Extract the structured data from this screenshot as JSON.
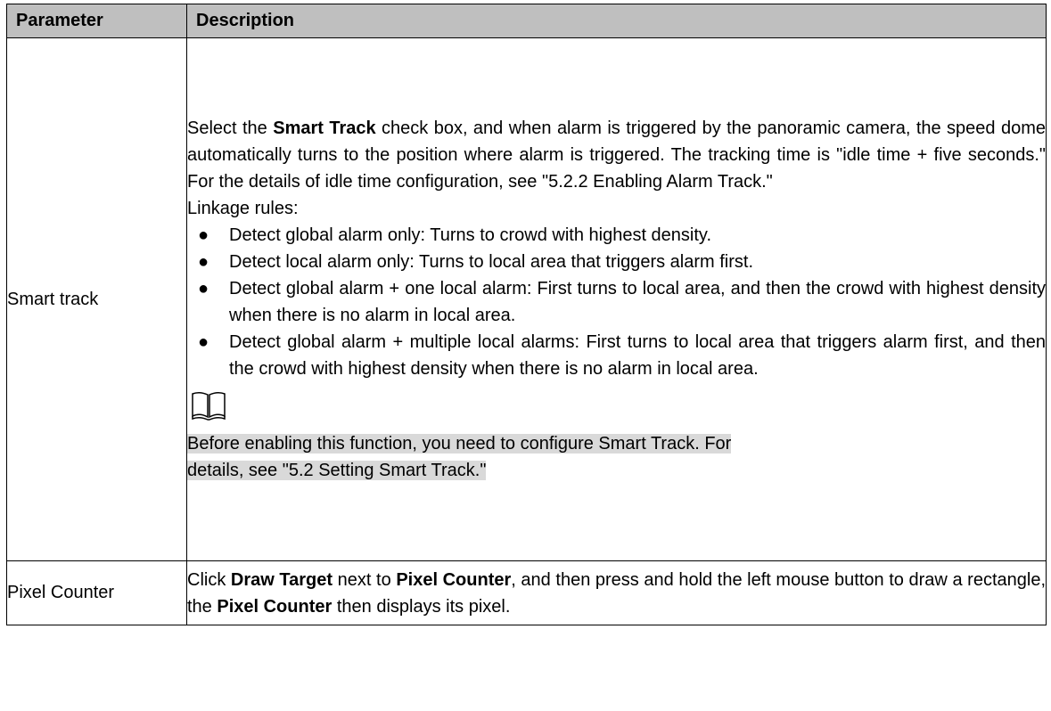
{
  "table": {
    "headers": {
      "parameter": "Parameter",
      "description": "Description"
    },
    "smart_track": {
      "name": "Smart track",
      "intro_1": "Select the ",
      "intro_bold": "Smart Track",
      "intro_2": " check box, and when alarm is triggered by the panoramic camera, the speed dome automatically turns to the position where alarm is triggered. The tracking time is \"idle time + five seconds.\" For the details of idle time configuration, see \"5.2.2 Enabling Alarm Track.\"",
      "rules_label": "Linkage rules:",
      "bullets": [
        "Detect global alarm only: Turns to crowd with highest density.",
        "Detect local alarm only: Turns to local area that triggers alarm first.",
        "Detect global alarm + one local alarm: First turns to local area, and then the crowd with highest density when there is no alarm in local area.",
        "Detect global alarm + multiple local alarms: First turns to local area that triggers alarm first, and then the crowd with highest density when there is no alarm in local area."
      ],
      "note_icon": "book-icon",
      "note_text_1": "Before enabling this function, you need to configure Smart Track. For",
      "note_text_2": "details, see \"5.2 Setting Smart Track.\""
    },
    "pixel_counter": {
      "name": "Pixel Counter",
      "t1": "Click ",
      "b1": "Draw Target",
      "t2": " next to ",
      "b2": "Pixel Counter",
      "t3": ", and then press and hold the left mouse button to draw a rectangle, the ",
      "b3": "Pixel Counter",
      "t4": " then displays its pixel."
    }
  }
}
